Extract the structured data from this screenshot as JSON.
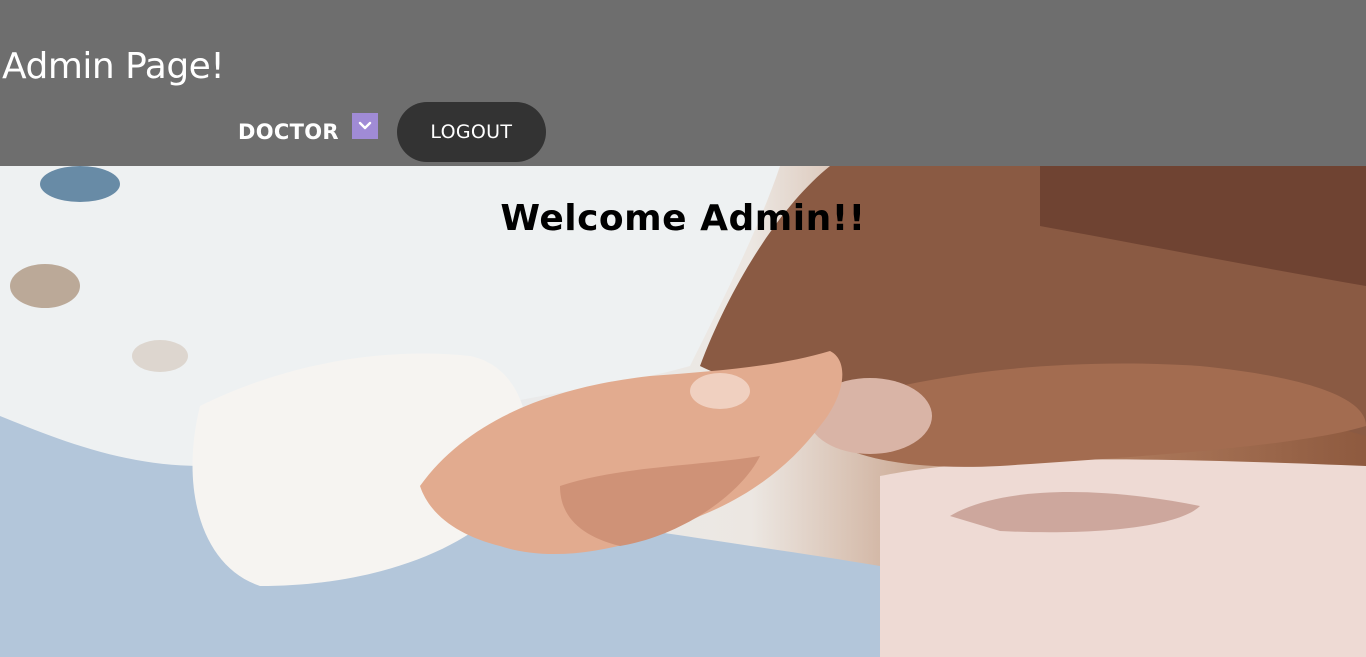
{
  "header": {
    "title": "Admin Page!",
    "nav": {
      "dropdown_label": "DOCTOR",
      "dropdown_icon": "chevron-down-icon",
      "logout_label": "LOGOUT"
    }
  },
  "hero": {
    "welcome_text": "Welcome  Admin!!",
    "image_subject": "baby-hand-holding-adult-finger-photo"
  },
  "colors": {
    "header_bg": "#6e6e6e",
    "logout_bg": "#333333",
    "dropdown_arrow_bg": "#a08bd6"
  }
}
